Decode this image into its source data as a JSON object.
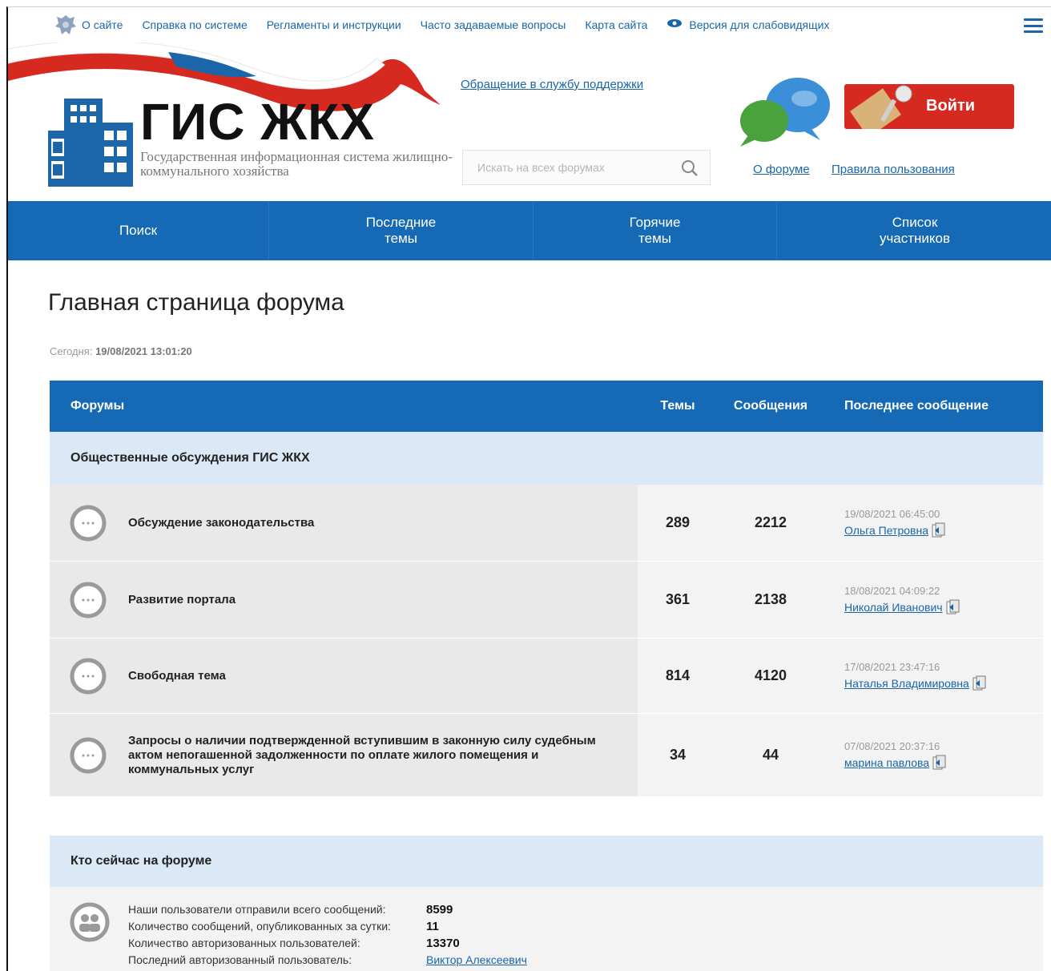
{
  "topnav": {
    "links": [
      "О сайте",
      "Справка по системе",
      "Регламенты и инструкции",
      "Часто задаваемые вопросы",
      "Карта сайта"
    ],
    "accessibility": "Версия для слабовидящих"
  },
  "header": {
    "logo_title": "ГИС ЖКХ",
    "logo_subtitle": "Государственная информационная система жилищно-коммунального хозяйства",
    "support_link": "Обращение в службу поддержки",
    "search_placeholder": "Искать на всех форумах",
    "login_label": "Войти",
    "forum_link": "О форуме",
    "rules_link": "Правила пользования"
  },
  "mainnav": {
    "items": [
      "Поиск",
      "Последние темы",
      "Горячие темы",
      "Список участников"
    ]
  },
  "page": {
    "title": "Главная страница форума",
    "today_label": "Сегодня:",
    "today_value": "19/08/2021 13:01:20"
  },
  "table": {
    "headers": [
      "Форумы",
      "Темы",
      "Сообщения",
      "Последнее сообщение"
    ],
    "category": "Общественные обсуждения ГИС ЖКХ",
    "rows": [
      {
        "name": "Обсуждение законодательства",
        "topics": "289",
        "messages": "2212",
        "last_date": "19/08/2021 06:45:00",
        "last_user": "Ольга Петровна"
      },
      {
        "name": "Развитие портала",
        "topics": "361",
        "messages": "2138",
        "last_date": "18/08/2021 04:09:22",
        "last_user": "Николай Иванович"
      },
      {
        "name": "Свободная тема",
        "topics": "814",
        "messages": "4120",
        "last_date": "17/08/2021 23:47:16",
        "last_user": "Наталья Владимировна"
      },
      {
        "name": "Запросы о наличии подтвержденной вступившим в законную силу судебным актом непогашенной задолженности по оплате жилого помещения и коммунальных услуг",
        "topics": "34",
        "messages": "44",
        "last_date": "07/08/2021 20:37:16",
        "last_user": "марина павлова"
      }
    ]
  },
  "who": {
    "title": "Кто сейчас на форуме",
    "stats": [
      {
        "label": "Наши пользователи отправили всего сообщений:",
        "value": "8599"
      },
      {
        "label": "Количество сообщений, опубликованных за сутки:",
        "value": "11"
      },
      {
        "label": "Количество авторизованных пользователей:",
        "value": "13370"
      },
      {
        "label": "Последний авторизованный пользователь:",
        "value": "Виктор Алексеевич"
      }
    ]
  },
  "colors": {
    "accent": "#1669b4",
    "login": "#d62a20",
    "link": "#1b66a8",
    "category_bg": "#dbe9f7"
  },
  "icons": [
    "emblem-icon",
    "eye-icon",
    "menu-icon",
    "search-icon",
    "chat-bubbles-icon",
    "keys-icon",
    "speech-bubble-icon",
    "document-icon",
    "users-icon"
  ]
}
